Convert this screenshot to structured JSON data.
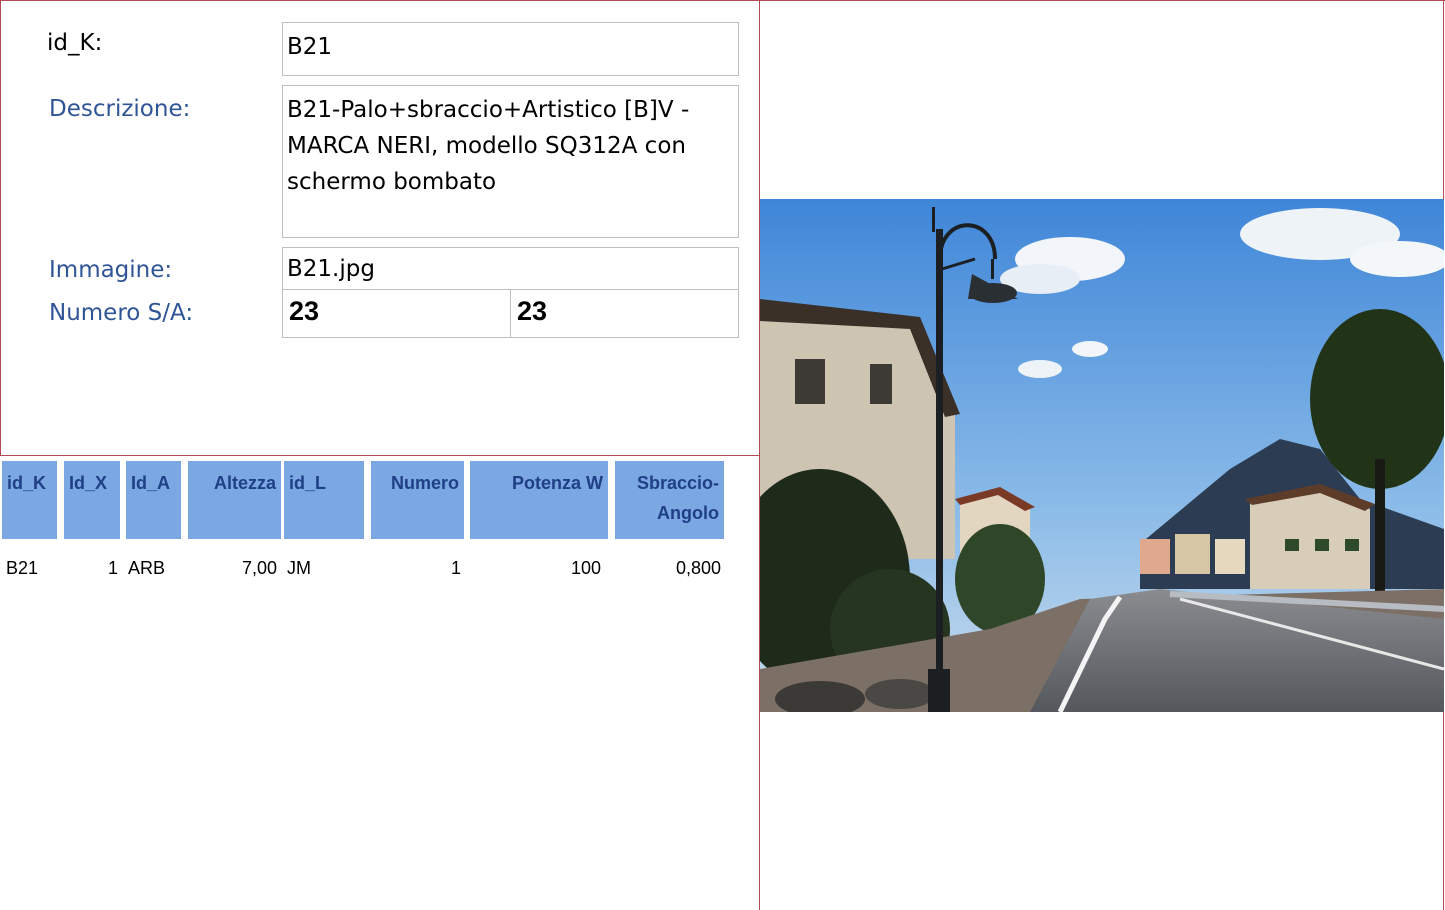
{
  "form": {
    "id_k_label": "id_K:",
    "id_k_value": "B21",
    "descrizione_label": "Descrizione:",
    "descrizione_value": "B21-Palo+sbraccio+Artistico [B]V - MARCA NERI, modello SQ312A con schermo bombato",
    "immagine_label": "Immagine:",
    "immagine_value": "B21.jpg",
    "numero_sa_label": "Numero S/A:",
    "numero_s": "23",
    "numero_a": "23"
  },
  "table": {
    "headers": [
      "id_K",
      "Id_X",
      "Id_A",
      "Altezza",
      "id_L",
      "Numero",
      "Potenza W",
      "Sbraccio-Angolo"
    ],
    "rows": [
      [
        "B21",
        "1",
        "ARB",
        "7,00",
        "JM",
        "1",
        "100",
        "0,800"
      ]
    ]
  },
  "photo": {
    "description_icon": "street-lamp-photo"
  },
  "colors": {
    "accent_border": "#b24a56",
    "header_fill": "#7ba7e3",
    "label_blue": "#2f5597"
  }
}
